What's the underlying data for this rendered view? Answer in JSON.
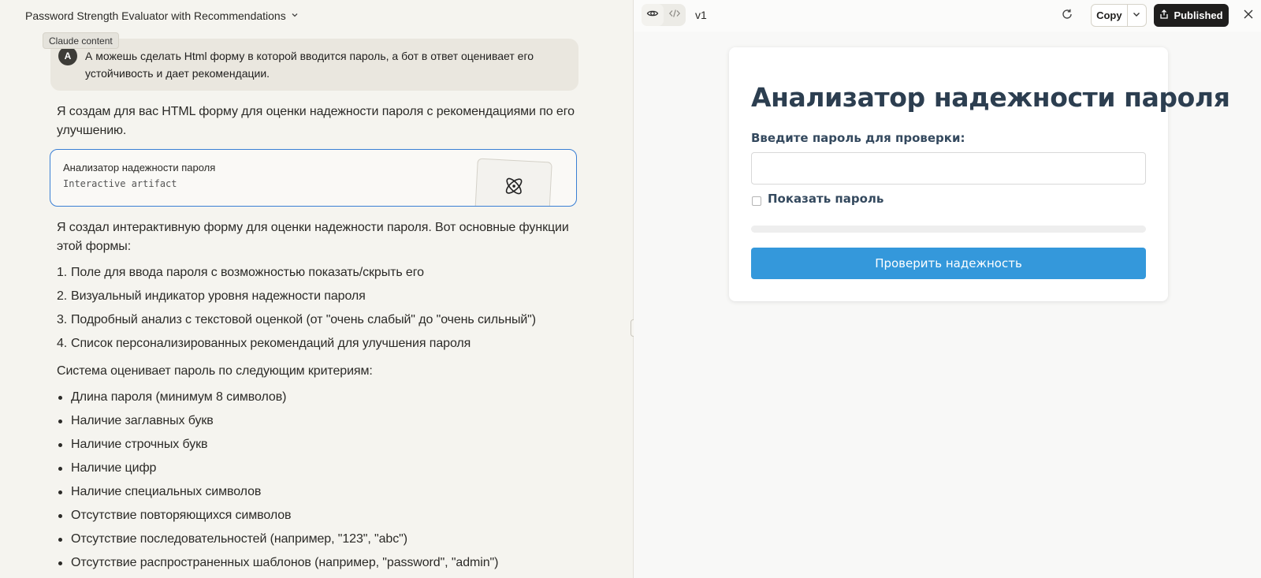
{
  "header": {
    "conversation_title": "Password Strength Evaluator with Recommendations",
    "tooltip": "Claude content"
  },
  "user_message": {
    "avatar_letter": "A",
    "text": "А можешь сделать Html форму в которой вводится пароль, а бот в ответ оценивает его устойчивость и дает рекомендации."
  },
  "assistant": {
    "intro": "Я создам для вас HTML форму для оценки надежности пароля с рекомендациями по его улучшению.",
    "artifact": {
      "title": "Анализатор надежности пароля",
      "subtitle": "Interactive artifact",
      "icon": "atom-icon"
    },
    "features_intro": "Я создал интерактивную форму для оценки надежности пароля. Вот основные функции этой формы:",
    "features": [
      "Поле для ввода пароля с возможностью показать/скрыть его",
      "Визуальный индикатор уровня надежности пароля",
      "Подробный анализ с текстовой оценкой (от \"очень слабый\" до \"очень сильный\")",
      "Список персонализированных рекомендаций для улучшения пароля"
    ],
    "criteria_intro": "Система оценивает пароль по следующим критериям:",
    "criteria": [
      "Длина пароля (минимум 8 символов)",
      "Наличие заглавных букв",
      "Наличие строчных букв",
      "Наличие цифр",
      "Наличие специальных символов",
      "Отсутствие повторяющихся символов",
      "Отсутствие последовательностей (например, \"123\", \"abc\")",
      "Отсутствие распространенных шаблонов (например, \"password\", \"admin\")"
    ]
  },
  "artifact_panel": {
    "version": "v1",
    "copy_label": "Copy",
    "publish_label": "Published",
    "preview": {
      "title": "Анализатор надежности пароля",
      "input_label": "Введите пароль для проверки:",
      "input_value": "",
      "show_password_label": "Показать пароль",
      "show_password_checked": false,
      "strength_level": 0,
      "button_label": "Проверить надежность"
    }
  },
  "colors": {
    "accent_blue": "#3498db",
    "heading": "#2c3e50",
    "label": "#34495e",
    "card_border": "#3a7fd4",
    "publish_bg": "#1f1e1d"
  }
}
